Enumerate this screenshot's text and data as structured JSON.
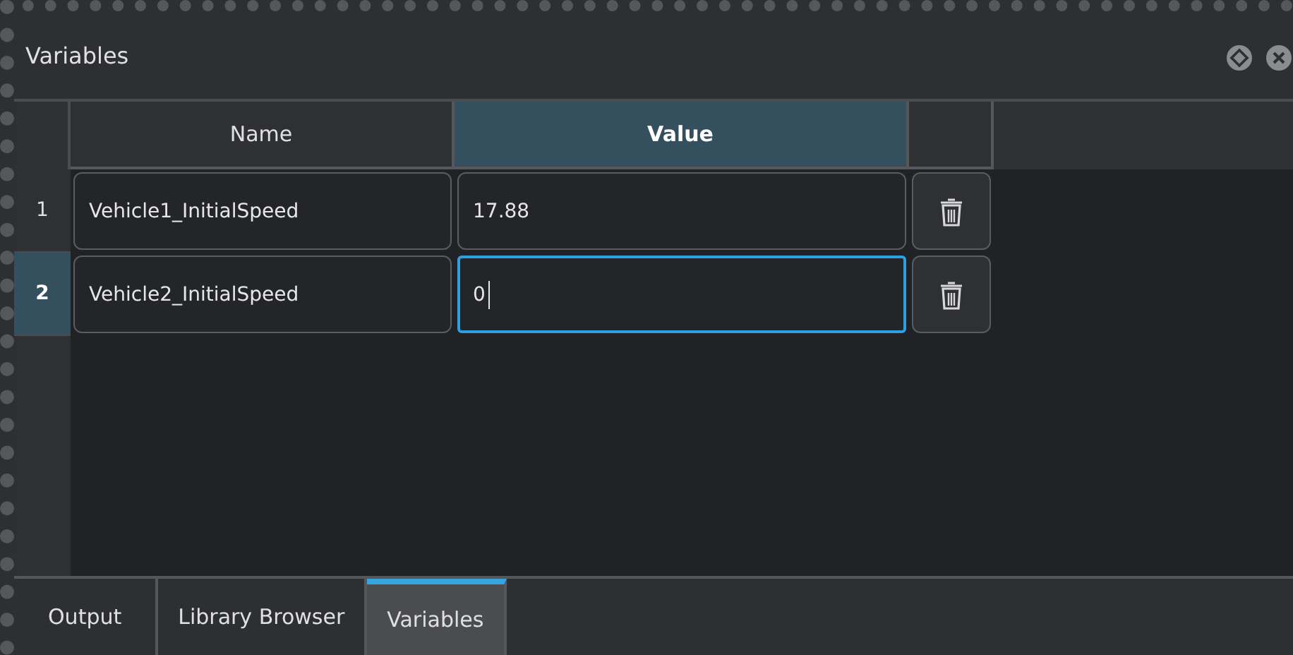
{
  "panel": {
    "title": "Variables"
  },
  "table": {
    "columns": [
      {
        "label": "Name",
        "selected": false
      },
      {
        "label": "Value",
        "selected": true
      }
    ],
    "rows": [
      {
        "number": "1",
        "name": "Vehicle1_InitialSpeed",
        "value": "17.88",
        "selected": false,
        "focused": false
      },
      {
        "number": "2",
        "name": "Vehicle2_InitialSpeed",
        "value": "0",
        "selected": true,
        "focused": true
      }
    ]
  },
  "tabs": [
    {
      "label": "Output",
      "selected": false
    },
    {
      "label": "Library Browser",
      "selected": false
    },
    {
      "label": "Variables",
      "selected": true
    }
  ]
}
